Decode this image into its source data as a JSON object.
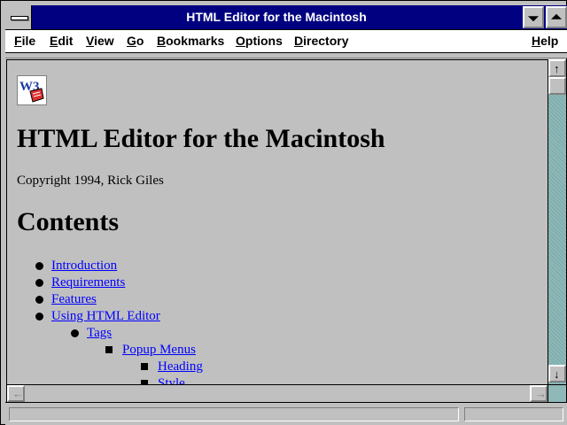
{
  "window": {
    "title": "HTML Editor for the Macintosh"
  },
  "menu": [
    {
      "label": "File",
      "mnemonic": "F",
      "rest": "ile"
    },
    {
      "label": "Edit",
      "mnemonic": "E",
      "rest": "dit"
    },
    {
      "label": "View",
      "mnemonic": "V",
      "rest": "iew"
    },
    {
      "label": "Go",
      "mnemonic": "G",
      "rest": "o"
    },
    {
      "label": "Bookmarks",
      "mnemonic": "B",
      "rest": "ookmarks"
    },
    {
      "label": "Options",
      "mnemonic": "O",
      "rest": "ptions"
    },
    {
      "label": "Directory",
      "mnemonic": "D",
      "rest": "irectory"
    },
    {
      "label": "Help",
      "mnemonic": "H",
      "rest": "elp"
    }
  ],
  "document": {
    "logo_text": "W3",
    "heading": "HTML Editor for the Macintosh",
    "copyright": "Copyright 1994, Rick Giles",
    "contents_heading": "Contents",
    "links": [
      {
        "text": "Introduction",
        "level": 1
      },
      {
        "text": "Requirements",
        "level": 1
      },
      {
        "text": "Features",
        "level": 1
      },
      {
        "text": "Using HTML Editor",
        "level": 1
      },
      {
        "text": "Tags",
        "level": 2
      },
      {
        "text": "Popup Menus",
        "level": 3
      },
      {
        "text": "Heading",
        "level": 4
      },
      {
        "text": "Style",
        "level": 4
      }
    ]
  },
  "colors": {
    "title_bar": "#000080",
    "link": "#0000ff",
    "background": "#c0c0c0",
    "scroll_track": "#8fb8b8"
  }
}
